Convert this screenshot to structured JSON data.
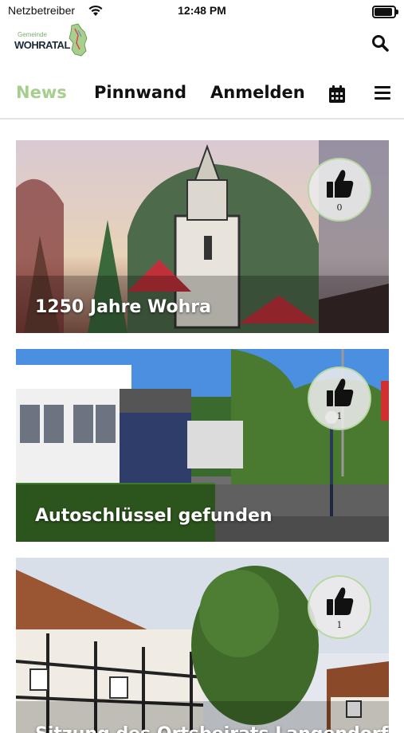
{
  "status_bar": {
    "carrier": "Netzbetreiber",
    "time": "12:48 PM",
    "battery_level": 0.85
  },
  "header": {
    "logo_small": "Gemeinde",
    "logo_big": "WOHRATAL"
  },
  "nav": {
    "tabs": [
      "News",
      "Pinnwand",
      "Anmelden"
    ],
    "active_tab": "News",
    "icons": [
      "calendar-icon",
      "menu-icon"
    ]
  },
  "cards": [
    {
      "title": "1250 Jahre Wohra",
      "likes": "0"
    },
    {
      "title": "Autoschlüssel gefunden",
      "likes": "1"
    },
    {
      "title": "Sitzung des Ortsbeirats Langendorf",
      "likes": "1"
    }
  ],
  "colors": {
    "accent": "#a6cf8f",
    "text": "#111111",
    "divider": "#e3e3e3"
  }
}
